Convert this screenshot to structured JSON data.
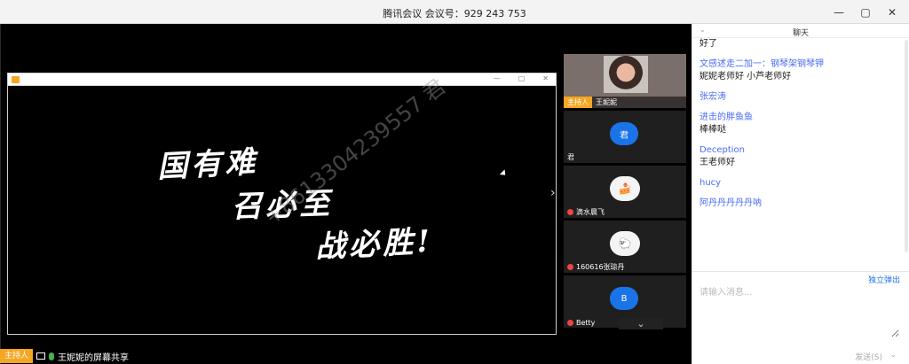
{
  "window": {
    "title": "腾讯会议  会议号：929 243 753",
    "controls": [
      "—",
      "▢",
      "✕"
    ]
  },
  "share": {
    "window_controls": [
      "—",
      "▢",
      "✕"
    ],
    "calligraphy": [
      "国有难",
      "召必至",
      "战必胜!"
    ],
    "watermark": "+8613304239557 君",
    "next_page": "›"
  },
  "participants": [
    {
      "name": "王妮妮",
      "host_tag": "主持人",
      "kind": "video"
    },
    {
      "name": "君",
      "avatar_text": "君",
      "kind": "letter"
    },
    {
      "name": "滴水晨飞",
      "kind": "image"
    },
    {
      "name": "160616张琼丹",
      "kind": "image"
    },
    {
      "name": "Betty",
      "avatar_text": "B",
      "kind": "letter"
    }
  ],
  "more_participants": "⌄",
  "sharebar": {
    "host_tag": "主持人",
    "label": "王妮妮的屏幕共享"
  },
  "chat": {
    "collapse": "⌄",
    "title": "聊天",
    "messages": [
      {
        "sender": "",
        "text": "好了"
      },
      {
        "sender": "文感述走二加一：钢琴架钢琴钾",
        "text": "妮妮老师好 小芦老师好"
      },
      {
        "sender": "张宏涛",
        "text": ""
      },
      {
        "sender": "进击的胖鱼鱼",
        "text": "棒棒哒"
      },
      {
        "sender": "Deception",
        "text": "王老师好"
      },
      {
        "sender": "hucy",
        "text": ""
      },
      {
        "sender": "阿丹丹丹丹丹呐",
        "text": ""
      }
    ],
    "popout": "独立弹出",
    "input_placeholder": "请输入消息...",
    "send": "发送(S)",
    "send_arrow": "⌄"
  },
  "colors": {
    "host_tag": "#f5a623",
    "link": "#4a6cf7",
    "avatar": "#1b73e8"
  }
}
